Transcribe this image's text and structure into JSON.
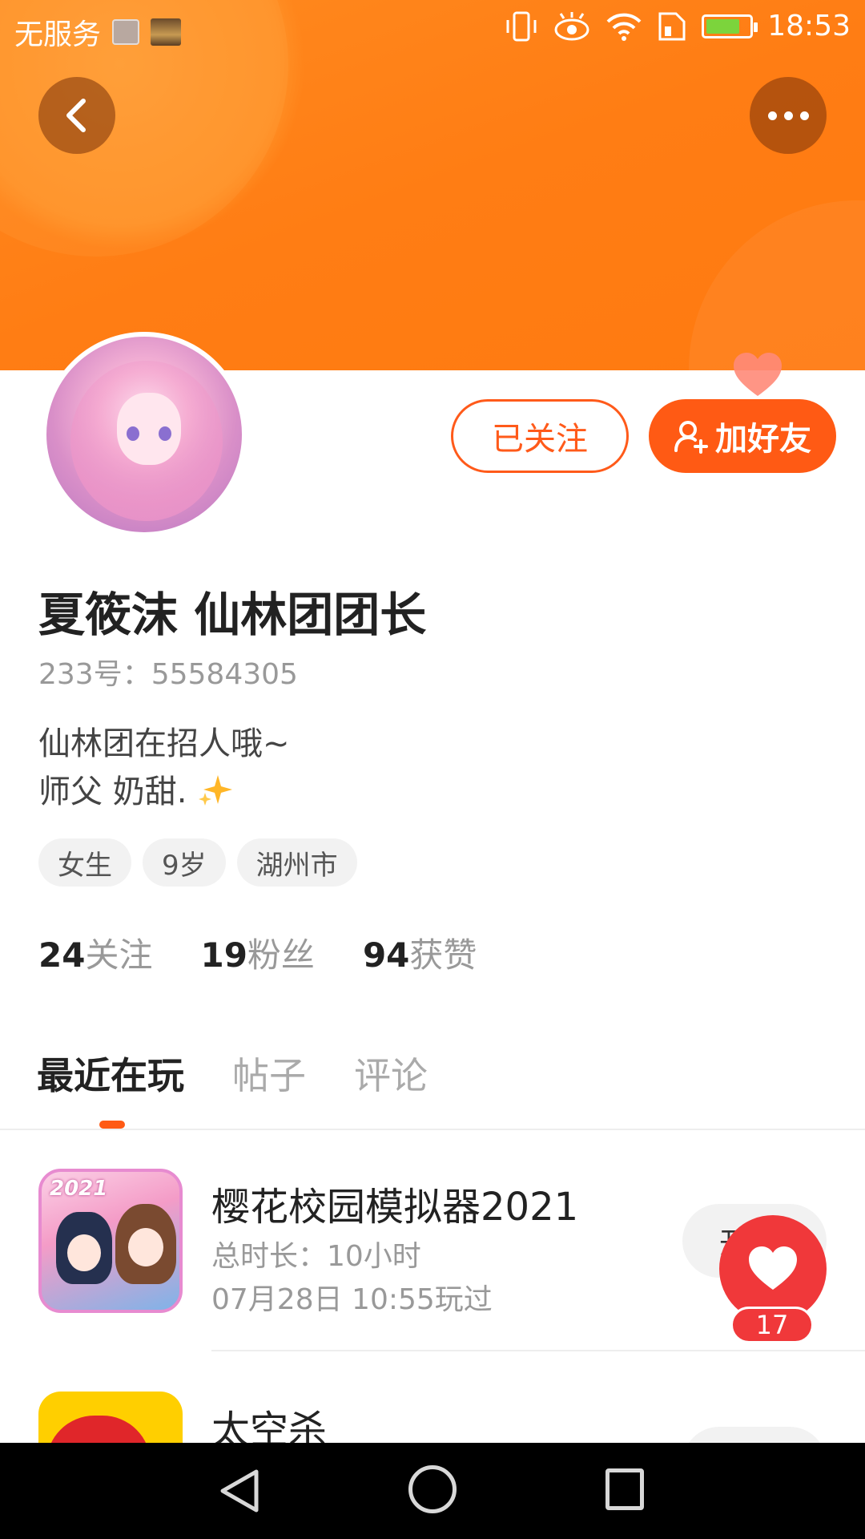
{
  "status_bar": {
    "carrier": "无服务",
    "time": "18:53"
  },
  "profile": {
    "username": "夏筱沫 仙林团团长",
    "user_id": "233号：55584305",
    "bio_line1": "仙林团在招人哦~",
    "bio_line2": "师父 奶甜.",
    "tags": [
      "女生",
      "9岁",
      "湖州市"
    ]
  },
  "actions": {
    "followed_label": "已关注",
    "add_friend_label": "加好友"
  },
  "stats": [
    {
      "value": "24",
      "label": "关注"
    },
    {
      "value": "19",
      "label": "粉丝"
    },
    {
      "value": "94",
      "label": "获赞"
    }
  ],
  "tabs": [
    {
      "label": "最近在玩",
      "active": true
    },
    {
      "label": "帖子",
      "active": false
    },
    {
      "label": "评论",
      "active": false
    }
  ],
  "games": [
    {
      "title": "樱花校园模拟器2021",
      "icon_badge": "2021",
      "duration": "总时长：10小时",
      "last_played": "07月28日 10:55玩过",
      "button_label": "开"
    },
    {
      "title": "太空杀",
      "button_label": ""
    }
  ],
  "floating_like": {
    "count": "17"
  },
  "colors": {
    "accent": "#ff5a14",
    "banner": "#ff7d14",
    "like": "#f0383a"
  },
  "icons": {
    "back": "chevron-left-icon",
    "more": "more-dots-icon",
    "add_friend": "person-add-icon",
    "like": "heart-icon"
  }
}
